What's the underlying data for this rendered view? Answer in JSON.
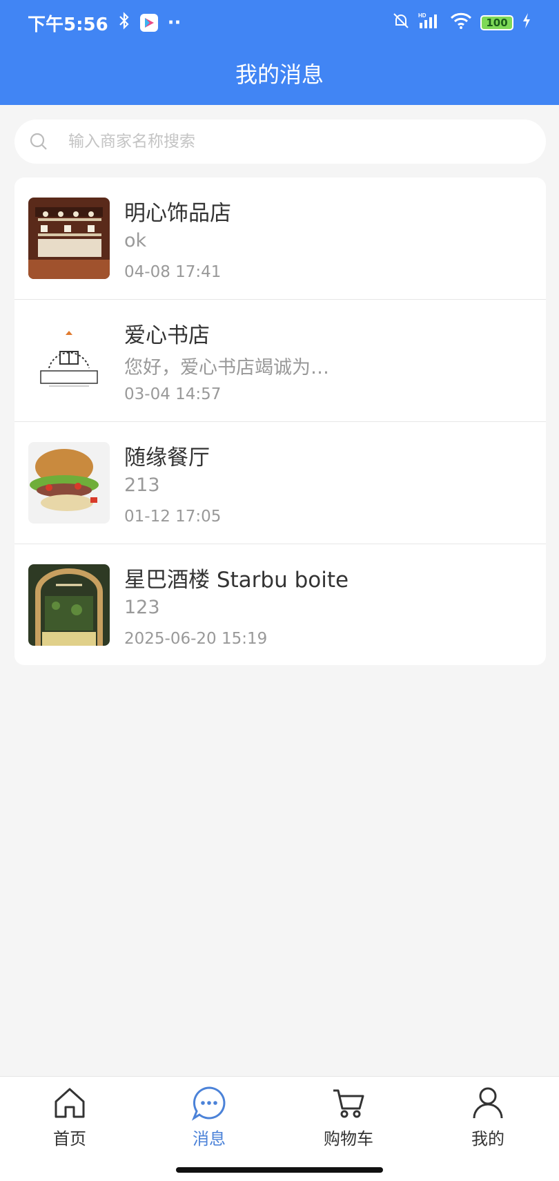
{
  "status_bar": {
    "time": "下午5:56",
    "dots": "··",
    "battery": "100"
  },
  "header": {
    "title": "我的消息"
  },
  "search": {
    "placeholder": "输入商家名称搜索"
  },
  "messages": [
    {
      "shop": "明心饰品店",
      "last_message": "ok",
      "time": "04-08 17:41"
    },
    {
      "shop": "爱心书店",
      "last_message": "您好，爱心书店竭诚为…",
      "time": "03-04 14:57"
    },
    {
      "shop": "随缘餐厅",
      "last_message": "213",
      "time": "01-12 17:05"
    },
    {
      "shop": "星巴酒楼 Starbu boite",
      "last_message": "123",
      "time": "2025-06-20 15:19"
    }
  ],
  "tabs": [
    {
      "label": "首页",
      "icon": "home-icon",
      "active": false
    },
    {
      "label": "消息",
      "icon": "chat-icon",
      "active": true
    },
    {
      "label": "购物车",
      "icon": "cart-icon",
      "active": false
    },
    {
      "label": "我的",
      "icon": "user-icon",
      "active": false
    }
  ],
  "colors": {
    "primary": "#4185f4",
    "active_tab": "#4b82d8",
    "background": "#f5f5f5"
  }
}
